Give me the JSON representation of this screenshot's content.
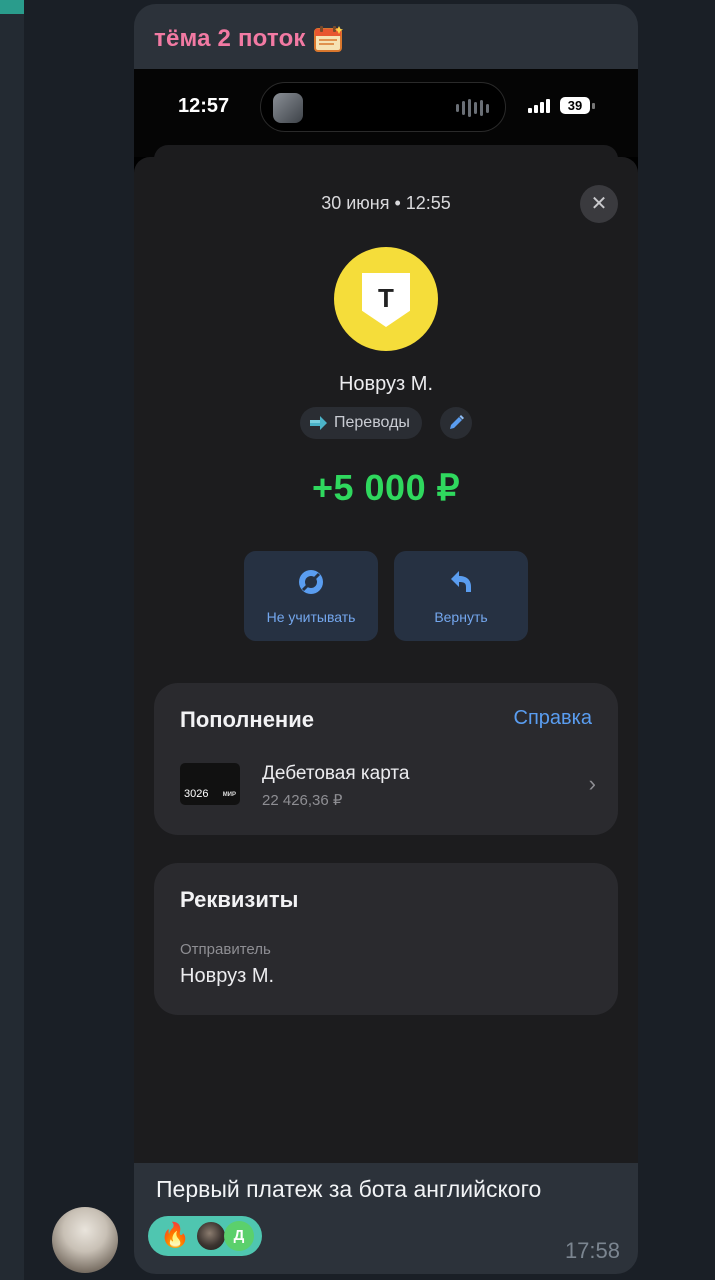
{
  "topic": {
    "title": "тёма 2 поток",
    "icon": "calendar-emoji-icon"
  },
  "phone": {
    "status_time": "12:57",
    "battery": "39",
    "transaction": {
      "date": "30 июня • 12:55",
      "close_icon": "close-icon",
      "merchant_name": "Новруз М.",
      "category": "Переводы",
      "amount": "+5 000 ₽",
      "actions": [
        {
          "label": "Не учитывать",
          "icon": "exclude-icon"
        },
        {
          "label": "Вернуть",
          "icon": "return-arrow-icon"
        }
      ],
      "topup": {
        "title": "Пополнение",
        "help_link": "Справка",
        "account_name": "Дебетовая карта",
        "account_balance": "22 426,36 ₽",
        "card_number": "3026",
        "card_brand": "МИР"
      },
      "requisites": {
        "title": "Реквизиты",
        "sender_label": "Отправитель",
        "sender_value": "Новруз М."
      }
    }
  },
  "message": {
    "caption": "Первый платеж за бота английского",
    "reaction_emoji": "🔥",
    "reaction_letter": "Д",
    "time": "17:58"
  },
  "colors": {
    "amount_green": "#2fd85e",
    "link_blue": "#5a9df0",
    "topic_pink": "#f27aa3",
    "brand_yellow": "#f5dd3a",
    "reaction_teal": "#4fc6b0"
  }
}
